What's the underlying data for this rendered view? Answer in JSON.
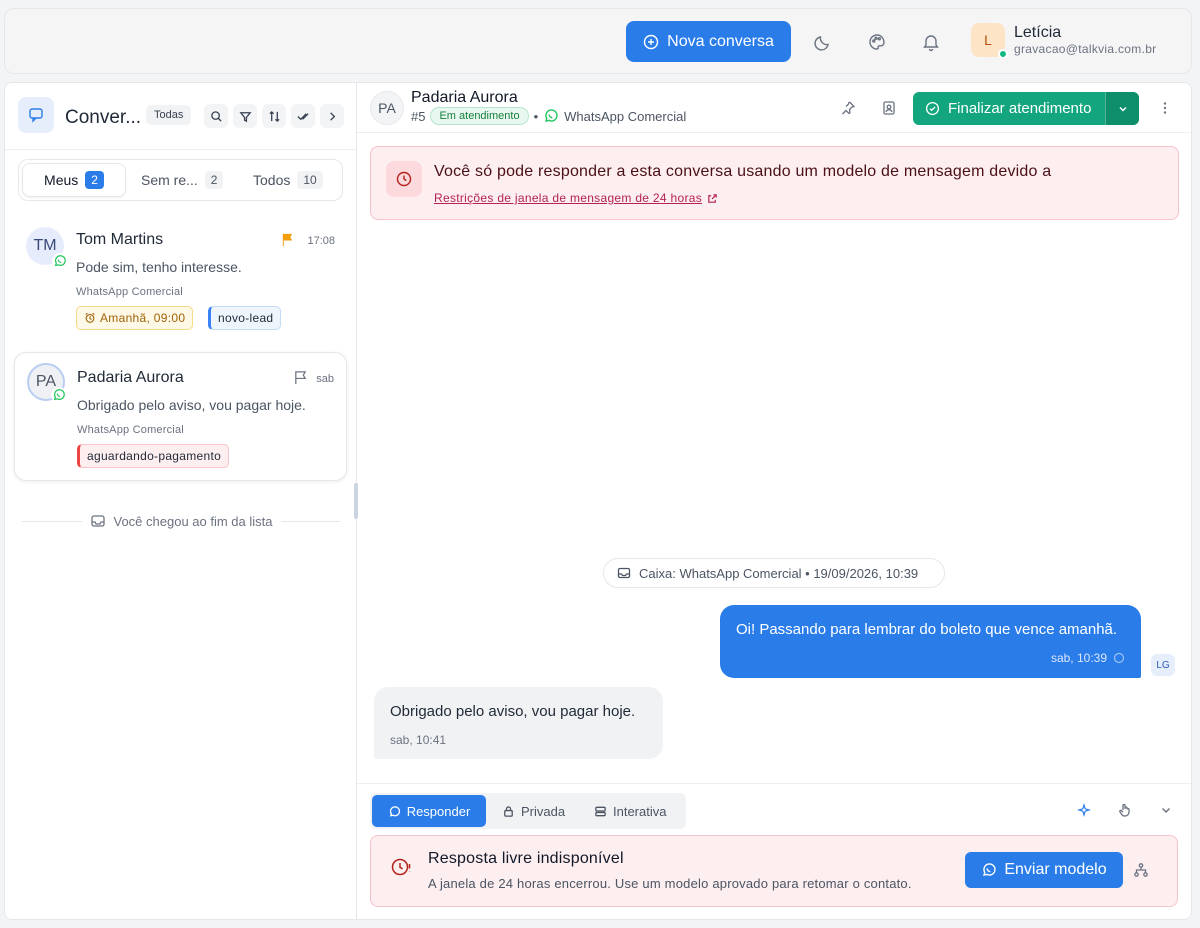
{
  "topbar": {
    "new_conversation_label": "Nova conversa",
    "user": {
      "initial": "L",
      "name": "Letícia",
      "email": "gravacao@talkvia.com.br",
      "status_color": "#10b981"
    }
  },
  "sidebar": {
    "title": "Conver...",
    "filter_chip": "Todas",
    "tabs": [
      {
        "label": "Meus",
        "count": "2"
      },
      {
        "label": "Sem re...",
        "count": "2"
      },
      {
        "label": "Todos",
        "count": "10"
      }
    ],
    "conversations": [
      {
        "initials": "TM",
        "name": "Tom Martins",
        "time": "17:08",
        "message": "Pode sim, tenho interesse.",
        "inbox": "WhatsApp Comercial",
        "reminder": "Amanhã, 09:00",
        "label": "novo-lead"
      },
      {
        "initials": "PA",
        "name": "Padaria Aurora",
        "time": "sab",
        "message": "Obrigado pelo aviso, vou pagar hoje.",
        "inbox": "WhatsApp Comercial",
        "label": "aguardando-pagamento"
      }
    ],
    "end_of_list": "Você chegou ao fim da lista"
  },
  "chat": {
    "contact": {
      "initials": "PA",
      "name": "Padaria Aurora",
      "id": "#5",
      "status": "Em atendimento",
      "inbox": "WhatsApp Comercial"
    },
    "finalize_label": "Finalizar atendimento",
    "alert": {
      "text": "Você só pode responder a esta conversa usando um modelo de mensagem devido a",
      "link": "Restrições de janela de mensagem de 24 horas"
    },
    "inbox_event": "Caixa: WhatsApp Comercial • 19/09/2026, 10:39",
    "messages": [
      {
        "direction": "out",
        "text": "Oi! Passando para lembrar do boleto que vence amanhã.",
        "time": "sab, 10:39",
        "agent": "LG"
      },
      {
        "direction": "in",
        "text": "Obrigado pelo aviso, vou pagar hoje.",
        "time": "sab, 10:41"
      }
    ],
    "composer": {
      "modes": [
        "Responder",
        "Privada",
        "Interativa"
      ],
      "blocked_title": "Resposta livre indisponível",
      "blocked_text": "A janela de 24 horas encerrou. Use um modelo aprovado para retomar o contato.",
      "send_template_label": "Enviar modelo"
    }
  },
  "colors": {
    "primary": "#2a7de9",
    "success": "#13a67e",
    "alert_bg": "#fdeef0",
    "whatsapp": "#22c55e"
  }
}
